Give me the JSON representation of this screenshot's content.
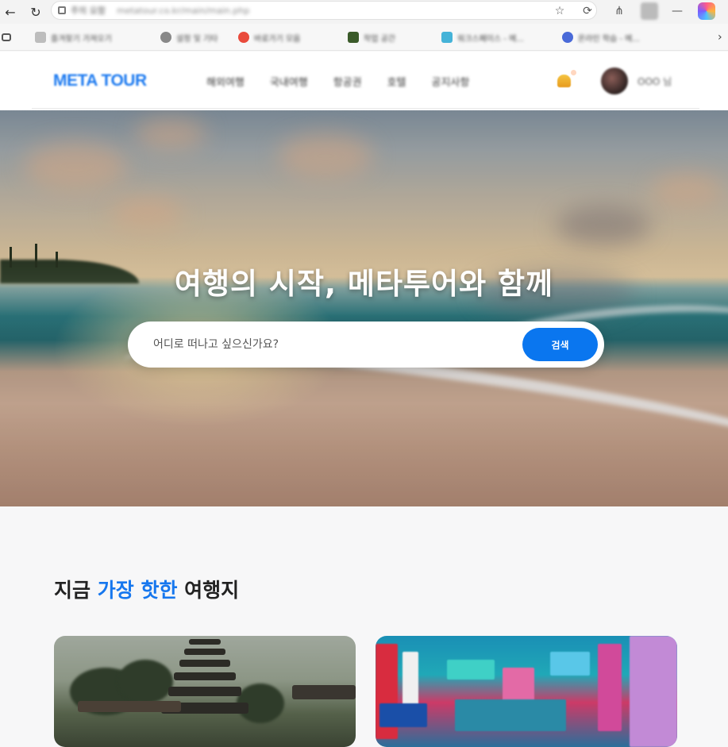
{
  "browser": {
    "address_label": "주의 요함",
    "url": "metatour.co.kr/main/main.php",
    "bookmarks": [
      {
        "label": "즐겨찾기 가져오기",
        "color": "#9a9a9a"
      },
      {
        "label": "설정 및 기타",
        "color": "#777777"
      },
      {
        "label": "바로가기 모음",
        "color": "#e94b3c"
      },
      {
        "label": "작업 공간",
        "color": "#3b5b2a"
      },
      {
        "label": "워크스페이스 - 메...",
        "color": "#45b3d8"
      },
      {
        "label": "온라인 학습 - 메...",
        "color": "#4a6ad8"
      }
    ],
    "icons": {
      "back": "arrow-left-icon",
      "refresh": "refresh-icon",
      "favorite": "star-icon",
      "more": "more-icon",
      "bookmark_more": "chevron-right-icon"
    }
  },
  "header": {
    "logo": "META TOUR",
    "nav": [
      "해외여행",
      "국내여행",
      "항공권",
      "호텔",
      "공지사항"
    ],
    "user_name": "OOO 님",
    "accent_color": "#1e7bf0"
  },
  "hero": {
    "title": "여행의 시작, 메타투어와 함께",
    "search_placeholder": "어디로 떠나고 싶으신가요?",
    "search_button": "검색",
    "button_color": "#0a76ef"
  },
  "hot": {
    "title_pre": "지금",
    "title_accent": "가장 핫한",
    "title_post": "여행지",
    "accent_color": "#1677ee"
  }
}
